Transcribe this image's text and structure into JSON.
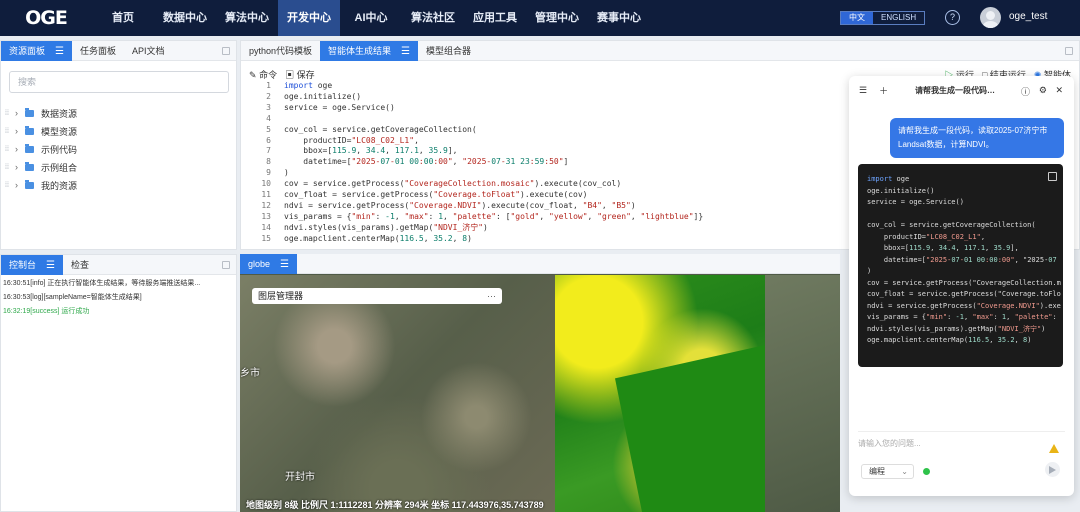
{
  "nav": {
    "logo": "OGE",
    "items": [
      "首页",
      "数据中心",
      "算法中心",
      "开发中心",
      "AI中心",
      "算法社区",
      "应用工具",
      "管理中心",
      "赛事中心"
    ],
    "active_index": 3,
    "lang": {
      "zh": "中文",
      "en": "ENGLISH"
    },
    "help": "?",
    "user": "oge_test"
  },
  "left_panel": {
    "tabs": [
      "资源面板",
      "任务面板",
      "API文档"
    ],
    "search_placeholder": "搜索",
    "tree": [
      "数据资源",
      "模型资源",
      "示例代码",
      "示例组合",
      "我的资源"
    ]
  },
  "editor": {
    "tabs": [
      "python代码模板",
      "智能体生成结果",
      "模型组合器"
    ],
    "toolbar": {
      "command": "命令",
      "save": "保存",
      "run": "运行",
      "stop": "结束运行",
      "agent": "智能体"
    },
    "lines": [
      "import oge",
      "oge.initialize()",
      "service = oge.Service()",
      "",
      "cov_col = service.getCoverageCollection(",
      "    productID=\"LC08_C02_L1\",",
      "    bbox=[115.9, 34.4, 117.1, 35.9],",
      "    datetime=[\"2025-07-01 00:00:00\", \"2025-07-31 23:59:50\"]",
      ")",
      "cov = service.getProcess(\"CoverageCollection.mosaic\").execute(cov_col)",
      "cov_float = service.getProcess(\"Coverage.toFloat\").execute(cov)",
      "ndvi = service.getProcess(\"Coverage.NDVI\").execute(cov_float, \"B4\", \"B5\")",
      "vis_params = {\"min\": -1, \"max\": 1, \"palette\": [\"gold\", \"yellow\", \"green\", \"lightblue\"]}",
      "ndvi.styles(vis_params).getMap(\"NDVI_济宁\")",
      "oge.mapclient.centerMap(116.5, 35.2, 8)"
    ]
  },
  "console": {
    "tabs": [
      "控制台",
      "检查"
    ],
    "logs": [
      {
        "time": "16:30:51",
        "level": "[info]",
        "text": "正在执行智能体生成结果，等待服务端推送结果..."
      },
      {
        "time": "16:30:53",
        "level": "[log]",
        "text": "[sampleName=智能体生成结果]"
      },
      {
        "time": "16:32:19",
        "level": "[success]",
        "text": "运行成功"
      }
    ]
  },
  "map": {
    "tab": "globe",
    "layer_manager": "图层管理器",
    "more": "···",
    "labels": [
      {
        "id": "city1",
        "text": "乡市"
      },
      {
        "id": "city2",
        "text": "开封市"
      }
    ],
    "status": "地图级别 8级 比例尺 1:1112281 分辨率 294米 坐标 117.443976,35.743789",
    "colors": {
      "ndvi_high": "#f2ec1c",
      "ndvi_low": "#1f8a14"
    }
  },
  "chat": {
    "title": "请帮我生成一段代码…",
    "user_message": "请帮我生成一段代码，读取2025-07济宁市Landsat数据，计算NDVI。",
    "code_lines": [
      "import oge",
      "oge.initialize()",
      "service = oge.Service()",
      "",
      "cov_col = service.getCoverageCollection(",
      "    productID=\"LC08_C02_L1\",",
      "    bbox=[115.9, 34.4, 117.1, 35.9],",
      "    datetime=[\"2025-07-01 00:00:00\", \"2025-07",
      ")",
      "cov = service.getProcess(\"CoverageCollection.m",
      "cov_float = service.getProcess(\"Coverage.toFlo",
      "ndvi = service.getProcess(\"Coverage.NDVI\").exe",
      "vis_params = {\"min\": -1, \"max\": 1, \"palette\":",
      "ndvi.styles(vis_params).getMap(\"NDVI_济宁\")",
      "oge.mapclient.centerMap(116.5, 35.2, 8)"
    ],
    "input_placeholder": "请输入您的问题...",
    "mode": "编程"
  }
}
